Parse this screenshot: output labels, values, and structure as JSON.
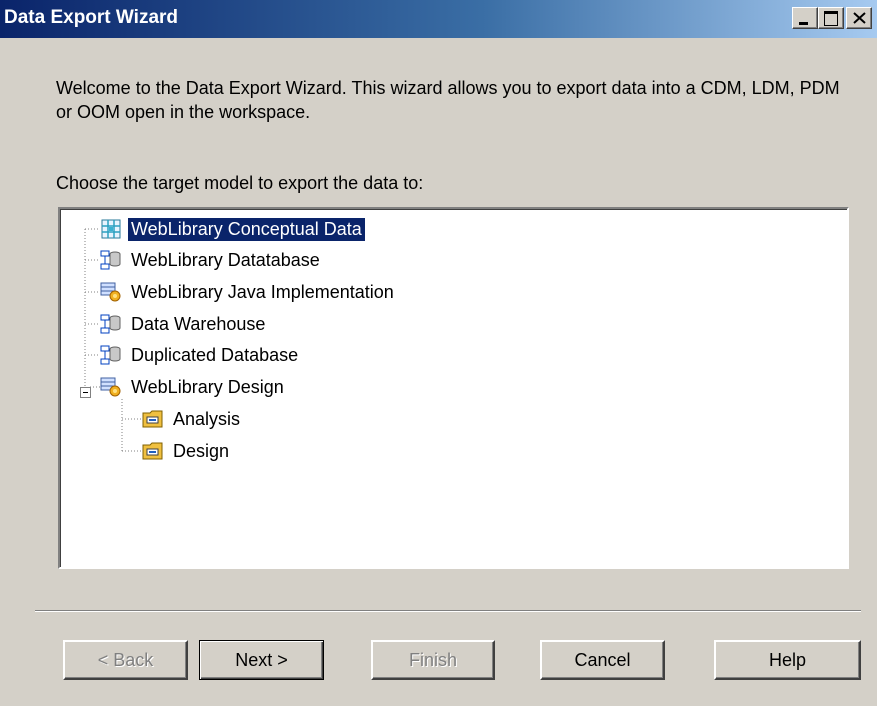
{
  "window": {
    "title": "Data Export Wizard"
  },
  "intro": {
    "text": "Welcome to the Data Export Wizard.  This wizard allows you to export data into a CDM, LDM, PDM or OOM open in the workspace."
  },
  "prompt": {
    "text": "Choose the target model to export the data to:"
  },
  "tree": {
    "selected_index": 0,
    "items": [
      {
        "label": "WebLibrary Conceptual Data",
        "icon": "conceptual-model-icon",
        "level": 0,
        "selected": true
      },
      {
        "label": "WebLibrary Datatabase",
        "icon": "physical-model-icon",
        "level": 0
      },
      {
        "label": "WebLibrary Java Implementation",
        "icon": "object-model-icon",
        "level": 0
      },
      {
        "label": "Data Warehouse",
        "icon": "physical-model-icon",
        "level": 0
      },
      {
        "label": "Duplicated Database",
        "icon": "physical-model-icon",
        "level": 0
      },
      {
        "label": "WebLibrary Design",
        "icon": "object-model-icon",
        "level": 0,
        "expanded": true
      },
      {
        "label": "Analysis",
        "icon": "package-icon",
        "level": 1
      },
      {
        "label": "Design",
        "icon": "package-icon",
        "level": 1
      }
    ]
  },
  "buttons": {
    "back": "< Back",
    "next": "Next >",
    "finish": "Finish",
    "cancel": "Cancel",
    "help": "Help"
  },
  "colors": {
    "title_bar_start": "#0a246a",
    "title_bar_end": "#a6caf0",
    "dialog_face": "#d4d0c8",
    "selection": "#0a246a"
  }
}
